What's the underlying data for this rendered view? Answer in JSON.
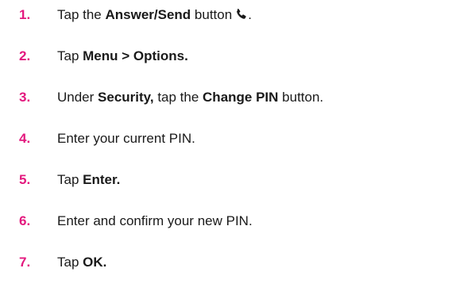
{
  "steps": [
    {
      "number": "1.",
      "parts": [
        {
          "text": "Tap the ",
          "bold": false
        },
        {
          "text": "Answer/Send",
          "bold": true
        },
        {
          "text": " button",
          "bold": false
        },
        {
          "icon": "phone-icon"
        },
        {
          "text": ".",
          "bold": false
        }
      ]
    },
    {
      "number": "2.",
      "parts": [
        {
          "text": "Tap ",
          "bold": false
        },
        {
          "text": "Menu > Options.",
          "bold": true
        }
      ]
    },
    {
      "number": "3.",
      "parts": [
        {
          "text": "Under ",
          "bold": false
        },
        {
          "text": "Security,",
          "bold": true
        },
        {
          "text": " tap the ",
          "bold": false
        },
        {
          "text": "Change PIN",
          "bold": true
        },
        {
          "text": " button.",
          "bold": false
        }
      ]
    },
    {
      "number": "4.",
      "parts": [
        {
          "text": "Enter your current PIN.",
          "bold": false
        }
      ]
    },
    {
      "number": "5.",
      "parts": [
        {
          "text": "Tap ",
          "bold": false
        },
        {
          "text": "Enter.",
          "bold": true
        }
      ]
    },
    {
      "number": "6.",
      "parts": [
        {
          "text": "Enter and confirm your new PIN.",
          "bold": false
        }
      ]
    },
    {
      "number": "7.",
      "parts": [
        {
          "text": "Tap ",
          "bold": false
        },
        {
          "text": "OK.",
          "bold": true
        }
      ]
    }
  ],
  "colors": {
    "step_number": "#e3187e",
    "text": "#1a1a1a"
  }
}
